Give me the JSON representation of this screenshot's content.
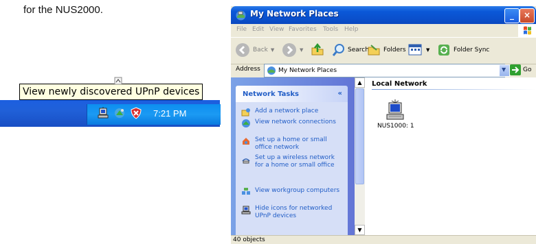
{
  "caption": "for the NUS2000.",
  "taskbar": {
    "tooltip": "View newly discovered UPnP devices",
    "clock": "7:21 PM",
    "icons": [
      "network-device-icon",
      "network-connection-icon",
      "security-shield-icon"
    ]
  },
  "window": {
    "title": "My Network Places",
    "menu": [
      "File",
      "Edit",
      "View",
      "Favorites",
      "Tools",
      "Help"
    ],
    "toolbar": {
      "back": "Back",
      "search": "Search",
      "folders": "Folders",
      "folder_sync": "Folder Sync"
    },
    "address": {
      "label": "Address",
      "value": "My Network Places",
      "go": "Go"
    },
    "tasks": {
      "title": "Network Tasks",
      "items": [
        "Add a network place",
        "View network connections",
        "Set up a home or small office network",
        "Set up a wireless network for a home or small office",
        "View workgroup computers",
        "Hide icons for networked UPnP devices"
      ]
    },
    "content": {
      "group_heading": "Local Network",
      "device_label": "NUS1000: 1"
    },
    "status": "40 objects"
  },
  "colors": {
    "titlebar": "#0a58d8",
    "taskbar": "#2060d8",
    "tray": "#1b9af3",
    "tooltip_bg": "#ffffe1",
    "task_link": "#215dc6"
  }
}
